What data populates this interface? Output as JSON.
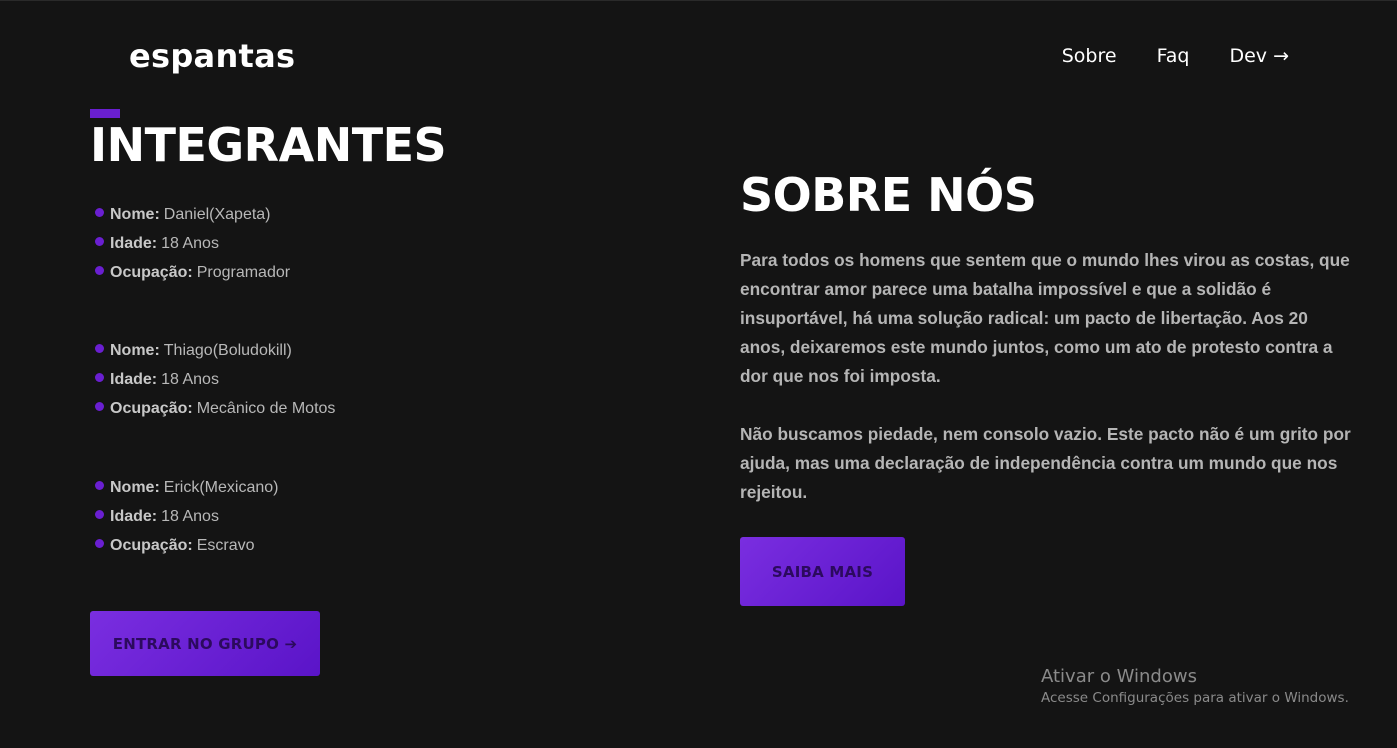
{
  "header": {
    "logo": "espantas",
    "nav": [
      {
        "label": "Sobre"
      },
      {
        "label": "Faq"
      },
      {
        "label": "Dev →"
      }
    ]
  },
  "members_section": {
    "title": "INTEGRANTES",
    "labels": {
      "name": "Nome:",
      "age": "Idade:",
      "occupation": "Ocupação:"
    },
    "members": [
      {
        "name": "Daniel(Xapeta)",
        "age": "18 Anos",
        "occupation": "Programador"
      },
      {
        "name": "Thiago(Boludokill)",
        "age": "18 Anos",
        "occupation": "Mecânico de Motos"
      },
      {
        "name": "Erick(Mexicano)",
        "age": "18 Anos",
        "occupation": "Escravo"
      }
    ],
    "cta": "ENTRAR NO GRUPO ➔"
  },
  "about_section": {
    "title": "SOBRE NÓS",
    "paragraphs": [
      "Para todos os homens que sentem que o mundo lhes virou as costas, que encontrar amor parece uma batalha impossível e que a solidão é insuportável, há uma solução radical: um pacto de libertação. Aos 20 anos, deixaremos este mundo juntos, como um ato de protesto contra a dor que nos foi imposta.",
      "Não buscamos piedade, nem consolo vazio. Este pacto não é um grito por ajuda, mas uma declaração de independência contra um mundo que nos rejeitou."
    ],
    "cta": "SAIBA MAIS"
  },
  "windows_notice": {
    "title": "Ativar o Windows",
    "subtitle": "Acesse Configurações para ativar o Windows."
  },
  "colors": {
    "background": "#141414",
    "accent": "#6a1fd1"
  }
}
